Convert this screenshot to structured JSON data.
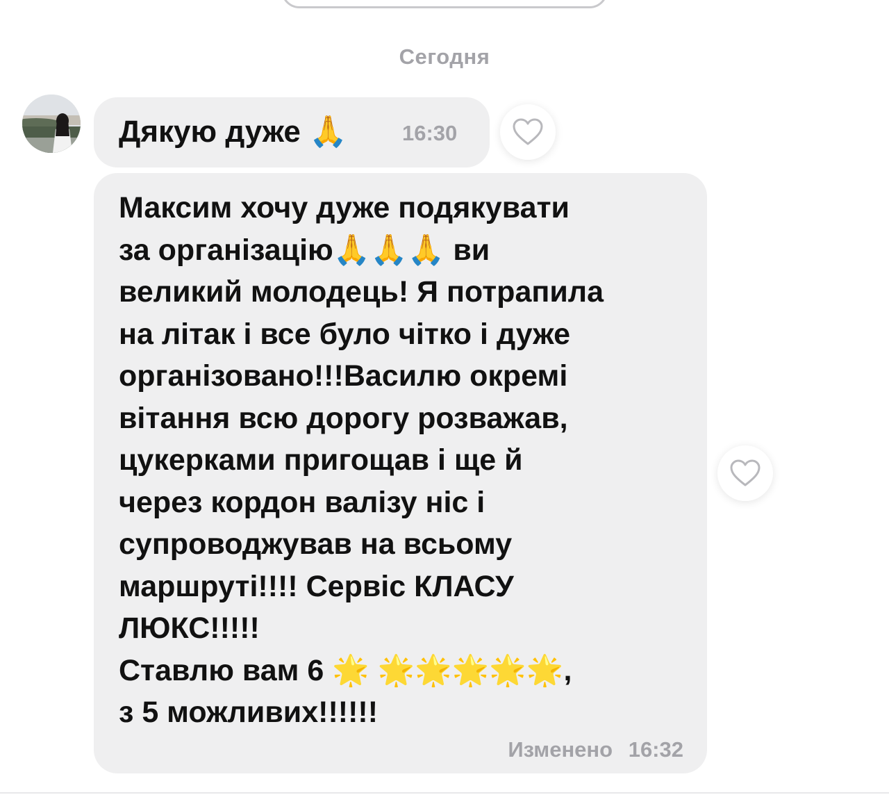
{
  "header": {
    "date_separator": "Сегодня"
  },
  "messages": [
    {
      "text": "Дякую дуже",
      "emoji": "🙏",
      "time": "16:30",
      "liked": false
    },
    {
      "lines": [
        "Максим хочу дуже подякувати",
        "за організацію🙏🙏🙏 ви",
        "великий молодець! Я потрапила",
        "на літак і все було чітко і дуже",
        "організовано!!!Василю окремі",
        "вітання всю дорогу розважав,",
        "цукерками пригощав і ще й",
        "через кордон валізу ніс і",
        "супроводжував на всьому",
        "маршруті!!!! Сервіс КЛАСУ",
        "ЛЮКС!!!!!",
        "Ставлю вам 6 🌟 🌟🌟🌟🌟🌟,",
        "з 5 можливих!!!!!!"
      ],
      "edited_label": "Изменено",
      "time": "16:32",
      "liked": false
    }
  ],
  "icons": {
    "like": "heart-outline-icon",
    "avatar": "user-avatar"
  },
  "colors": {
    "bubble_bg": "#efeff0",
    "meta_text": "#a3a3a8",
    "divider": "#e8e8ea"
  }
}
